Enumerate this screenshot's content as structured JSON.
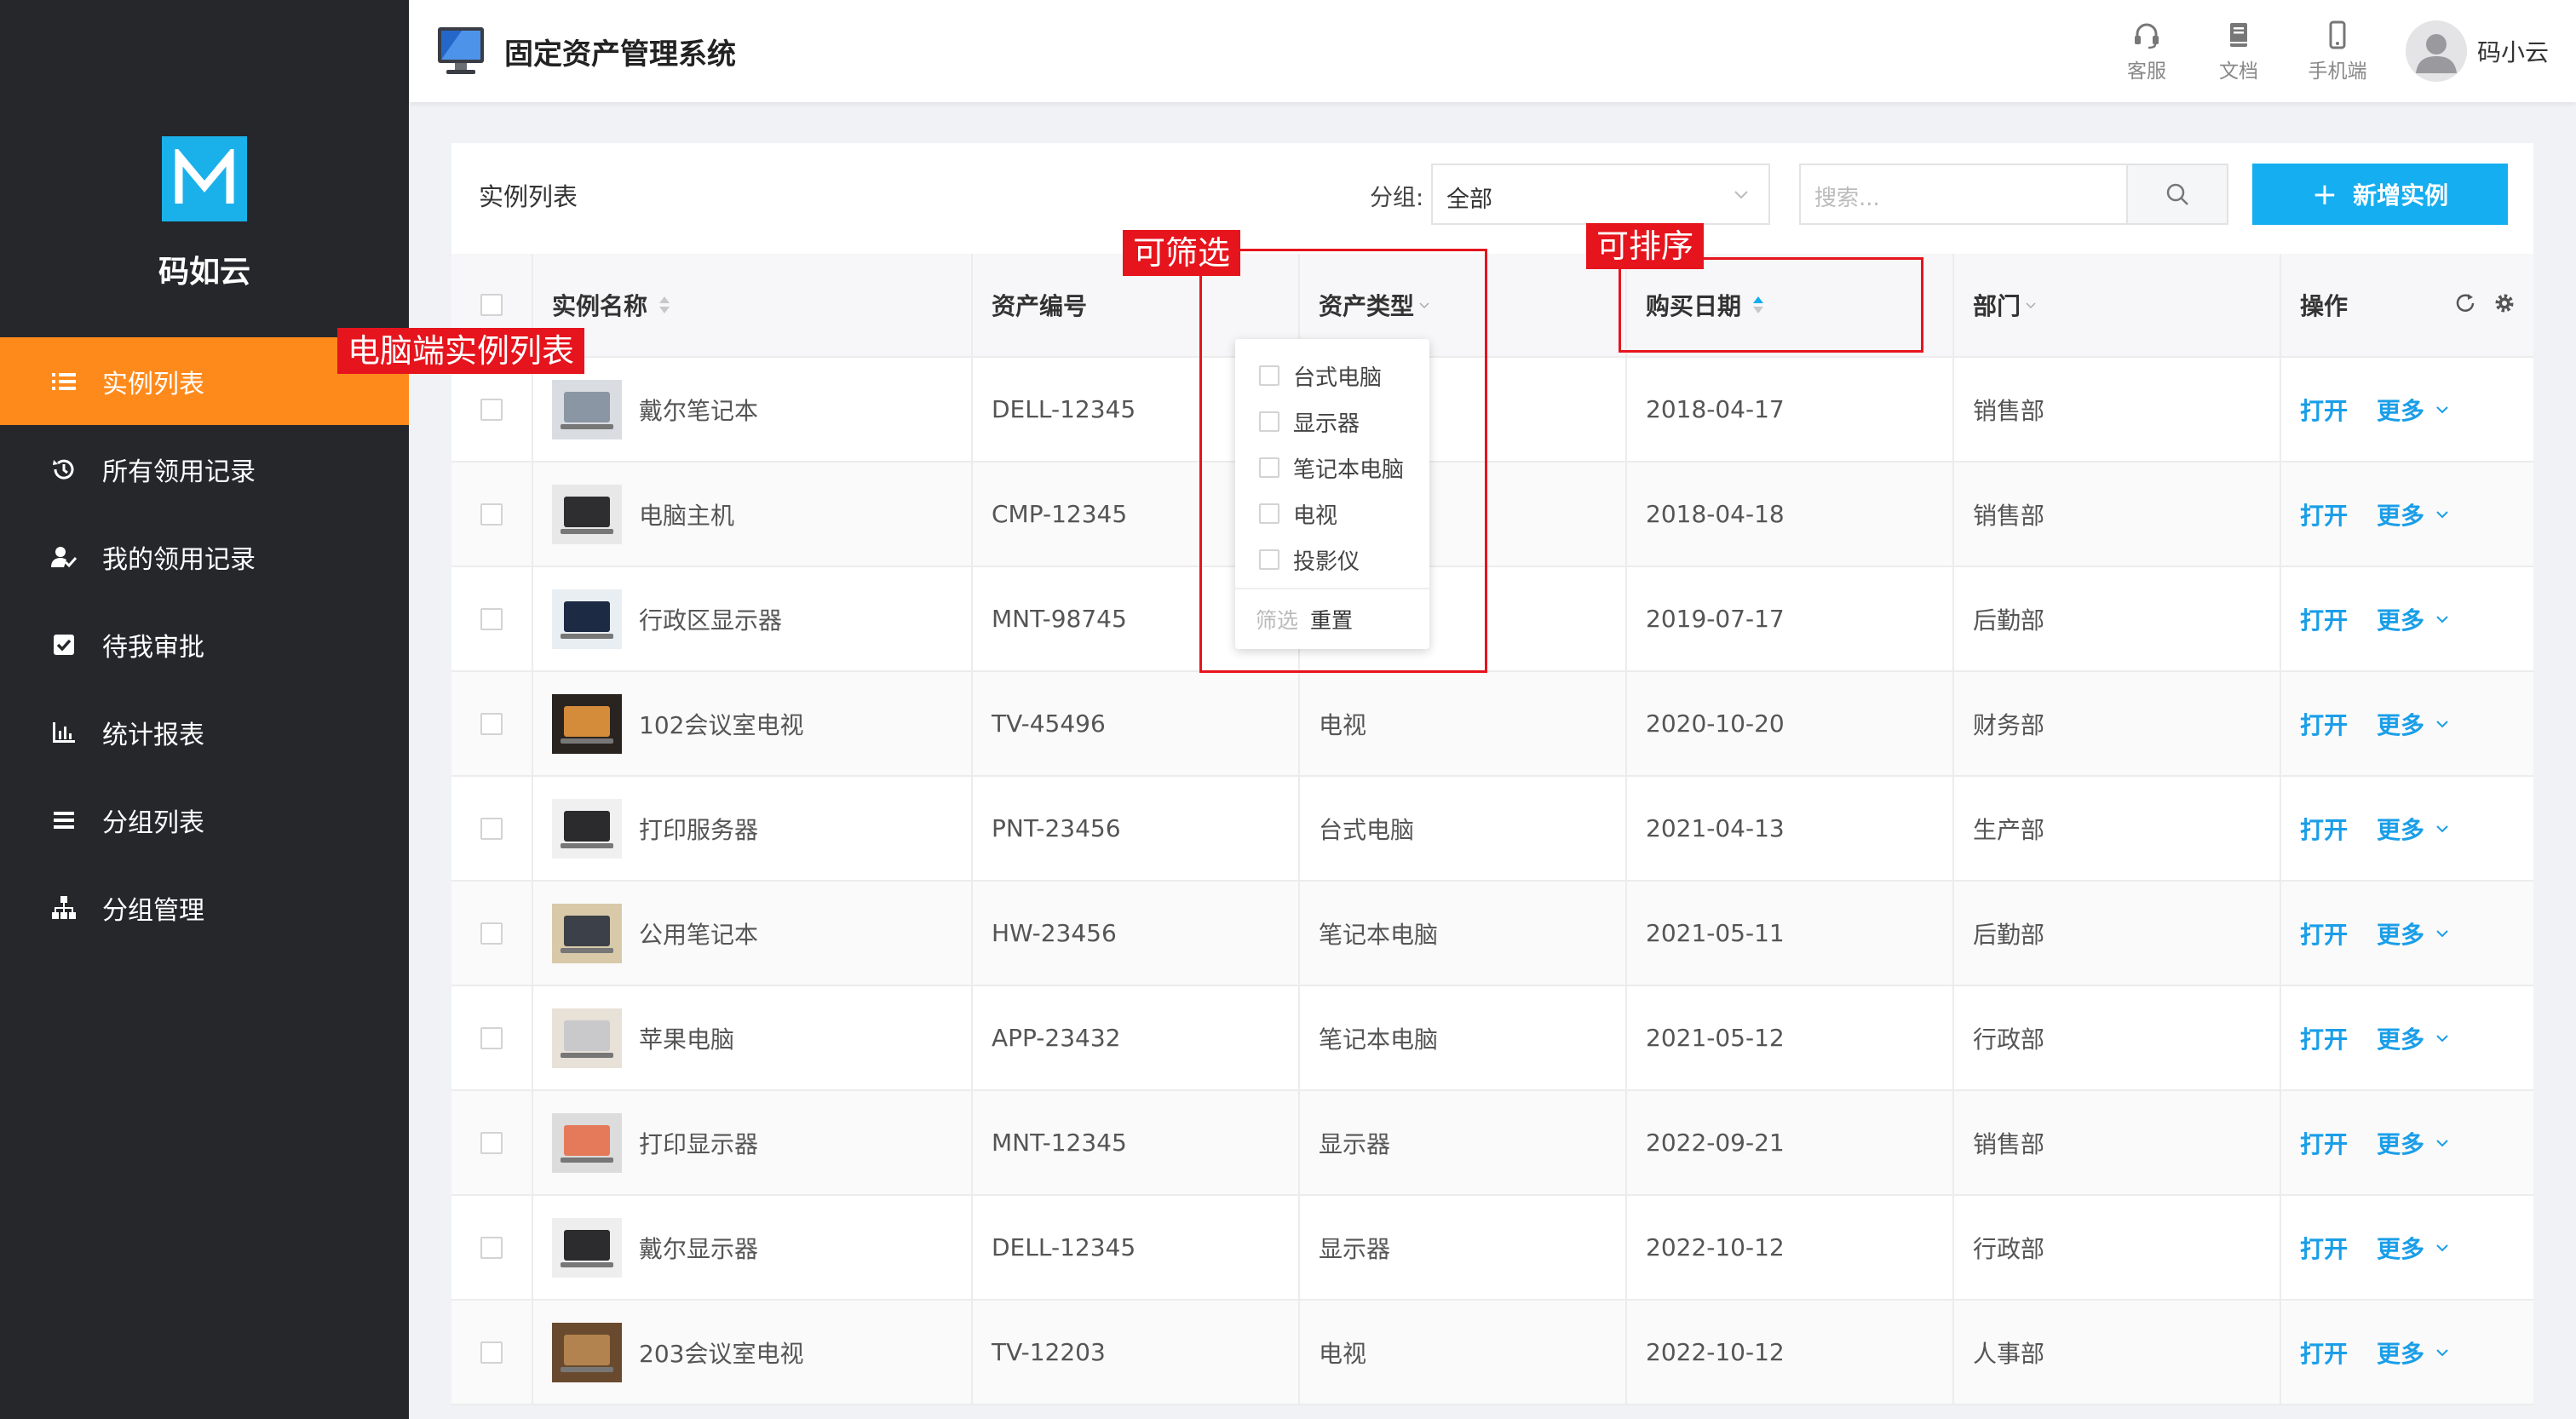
{
  "sidebar": {
    "brand": "码如云",
    "items": [
      {
        "label": "实例列表",
        "icon": "list-icon",
        "active": true
      },
      {
        "label": "所有领用记录",
        "icon": "history-icon",
        "active": false
      },
      {
        "label": "我的领用记录",
        "icon": "user-check-icon",
        "active": false
      },
      {
        "label": "待我审批",
        "icon": "checkbox-icon",
        "active": false
      },
      {
        "label": "统计报表",
        "icon": "bar-chart-icon",
        "active": false
      },
      {
        "label": "分组列表",
        "icon": "menu-lines-icon",
        "active": false
      },
      {
        "label": "分组管理",
        "icon": "org-tree-icon",
        "active": false
      }
    ]
  },
  "header": {
    "title": "固定资产管理系统",
    "tools": [
      {
        "label": "客服",
        "icon": "headset-icon"
      },
      {
        "label": "文档",
        "icon": "book-icon"
      },
      {
        "label": "手机端",
        "icon": "phone-icon"
      }
    ],
    "user": "码小云"
  },
  "toolbar": {
    "title": "实例列表",
    "group_label": "分组:",
    "group_value": "全部",
    "search_placeholder": "搜索...",
    "add_label": "新增实例"
  },
  "table": {
    "columns": [
      "实例名称",
      "资产编号",
      "资产类型",
      "购买日期",
      "部门",
      "操作"
    ],
    "action_open": "打开",
    "action_more": "更多",
    "rows": [
      {
        "name": "戴尔笔记本",
        "code": "DELL-12345",
        "type": "",
        "date": "2018-04-17",
        "dept": "销售部"
      },
      {
        "name": "电脑主机",
        "code": "CMP-12345",
        "type": "",
        "date": "2018-04-18",
        "dept": "销售部"
      },
      {
        "name": "行政区显示器",
        "code": "MNT-98745",
        "type": "",
        "date": "2019-07-17",
        "dept": "后勤部"
      },
      {
        "name": "102会议室电视",
        "code": "TV-45496",
        "type": "电视",
        "date": "2020-10-20",
        "dept": "财务部"
      },
      {
        "name": "打印服务器",
        "code": "PNT-23456",
        "type": "台式电脑",
        "date": "2021-04-13",
        "dept": "生产部"
      },
      {
        "name": "公用笔记本",
        "code": "HW-23456",
        "type": "笔记本电脑",
        "date": "2021-05-11",
        "dept": "后勤部"
      },
      {
        "name": "苹果电脑",
        "code": "APP-23432",
        "type": "笔记本电脑",
        "date": "2021-05-12",
        "dept": "行政部"
      },
      {
        "name": "打印显示器",
        "code": "MNT-12345",
        "type": "显示器",
        "date": "2022-09-21",
        "dept": "销售部"
      },
      {
        "name": "戴尔显示器",
        "code": "DELL-12345",
        "type": "显示器",
        "date": "2022-10-12",
        "dept": "行政部"
      },
      {
        "name": "203会议室电视",
        "code": "TV-12203",
        "type": "电视",
        "date": "2022-10-12",
        "dept": "人事部"
      }
    ]
  },
  "filter_dropdown": {
    "options": [
      "台式电脑",
      "显示器",
      "笔记本电脑",
      "电视",
      "投影仪"
    ],
    "apply": "筛选",
    "reset": "重置"
  },
  "annotations": {
    "sidebar_note": "电脑端实例列表",
    "filter_note": "可筛选",
    "sort_note": "可排序"
  },
  "colors": {
    "sidebar_bg": "#26272b",
    "active_item": "#ff8a1c",
    "primary": "#15aef0",
    "link": "#1a9ee8",
    "annotation": "#e6141d"
  }
}
